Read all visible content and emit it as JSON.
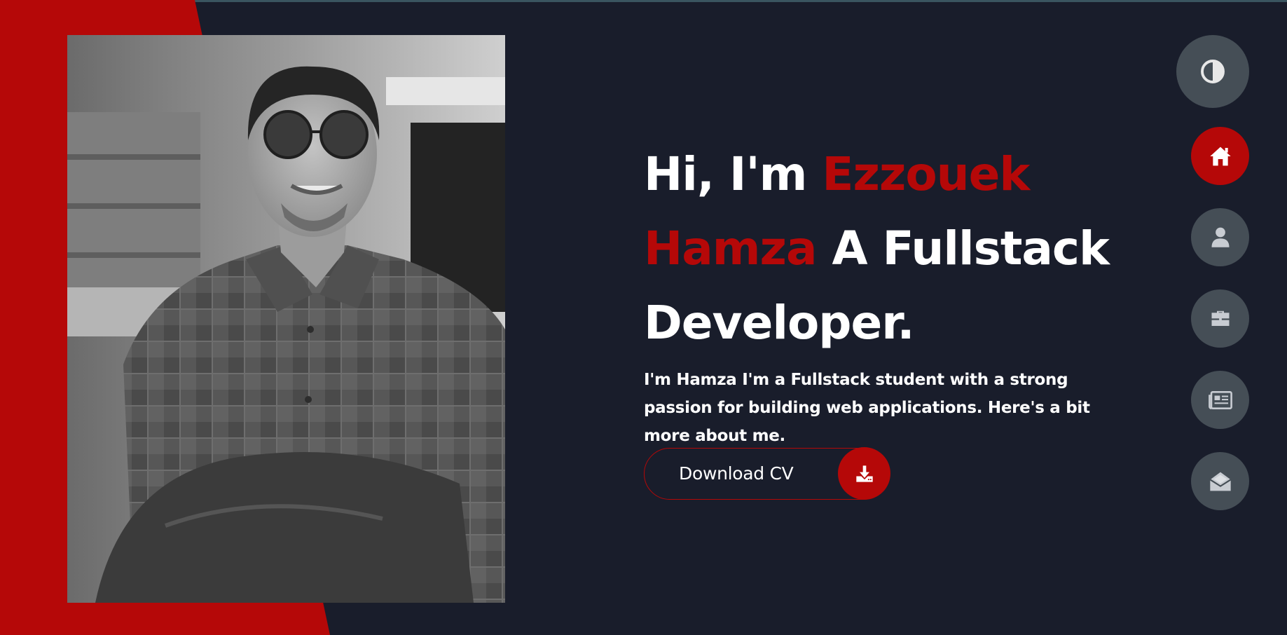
{
  "hero": {
    "greeting": "Hi, I'm ",
    "name": "Ezzouek Hamza",
    "role": " A Fullstack Developer.",
    "bio": "I'm Hamza I'm a Fullstack student with a strong passion for building web applications. Here's a bit more about me."
  },
  "cv_button": {
    "label": "Download CV",
    "icon": "download-icon"
  },
  "nav": {
    "theme_icon": "contrast-icon",
    "items": [
      {
        "icon": "home-icon",
        "active": true
      },
      {
        "icon": "user-icon",
        "active": false
      },
      {
        "icon": "briefcase-icon",
        "active": false
      },
      {
        "icon": "newspaper-icon",
        "active": false
      },
      {
        "icon": "envelope-open-icon",
        "active": false
      }
    ]
  },
  "colors": {
    "background": "#191d2b",
    "accent": "#b50808",
    "nav_button": "#454e56",
    "text": "#ffffff"
  }
}
